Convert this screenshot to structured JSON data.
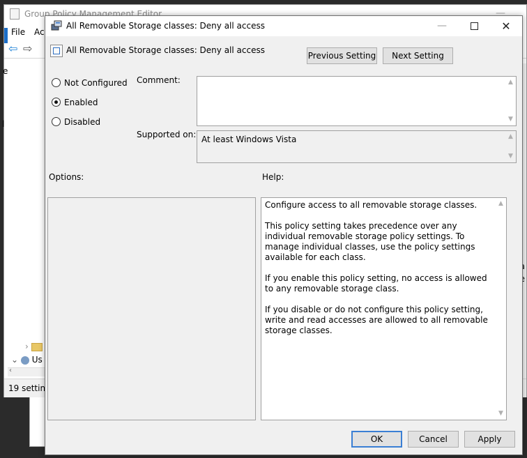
{
  "background_window": {
    "title": "Group Policy Management Editor",
    "menu": {
      "file": "File",
      "action": "Ac"
    },
    "tree": {
      "item_user": "Us"
    },
    "status": "19 setting"
  },
  "dialog": {
    "title": "All Removable Storage classes: Deny all access",
    "header_title": "All Removable Storage classes: Deny all access",
    "buttons": {
      "previous": "Previous Setting",
      "next": "Next Setting",
      "ok": "OK",
      "cancel": "Cancel",
      "apply": "Apply"
    },
    "radios": {
      "not_configured": "Not Configured",
      "enabled": "Enabled",
      "disabled": "Disabled",
      "selected": "enabled"
    },
    "labels": {
      "comment": "Comment:",
      "supported_on": "Supported on:",
      "options": "Options:",
      "help": "Help:"
    },
    "comment_value": "",
    "supported_on_value": "At least Windows Vista",
    "help_paragraphs": [
      "Configure access to all removable storage classes.",
      "This policy setting takes precedence over any individual removable storage policy settings. To manage individual classes, use the policy settings available for each class.",
      "If you enable this policy setting, no access is allowed to any removable storage class.",
      "If you disable or do not configure this policy setting, write and read accesses are allowed to all removable storage classes."
    ]
  },
  "colors": {
    "accent": "#3a7fd4",
    "dialog_bg": "#f0f0f0",
    "button_bg": "#e1e1e1"
  },
  "icons": {
    "window_close": "close-icon",
    "window_maximize": "maximize-icon",
    "window_minimize": "minimize-icon",
    "back": "arrow-left-icon",
    "forward": "arrow-right-icon"
  }
}
